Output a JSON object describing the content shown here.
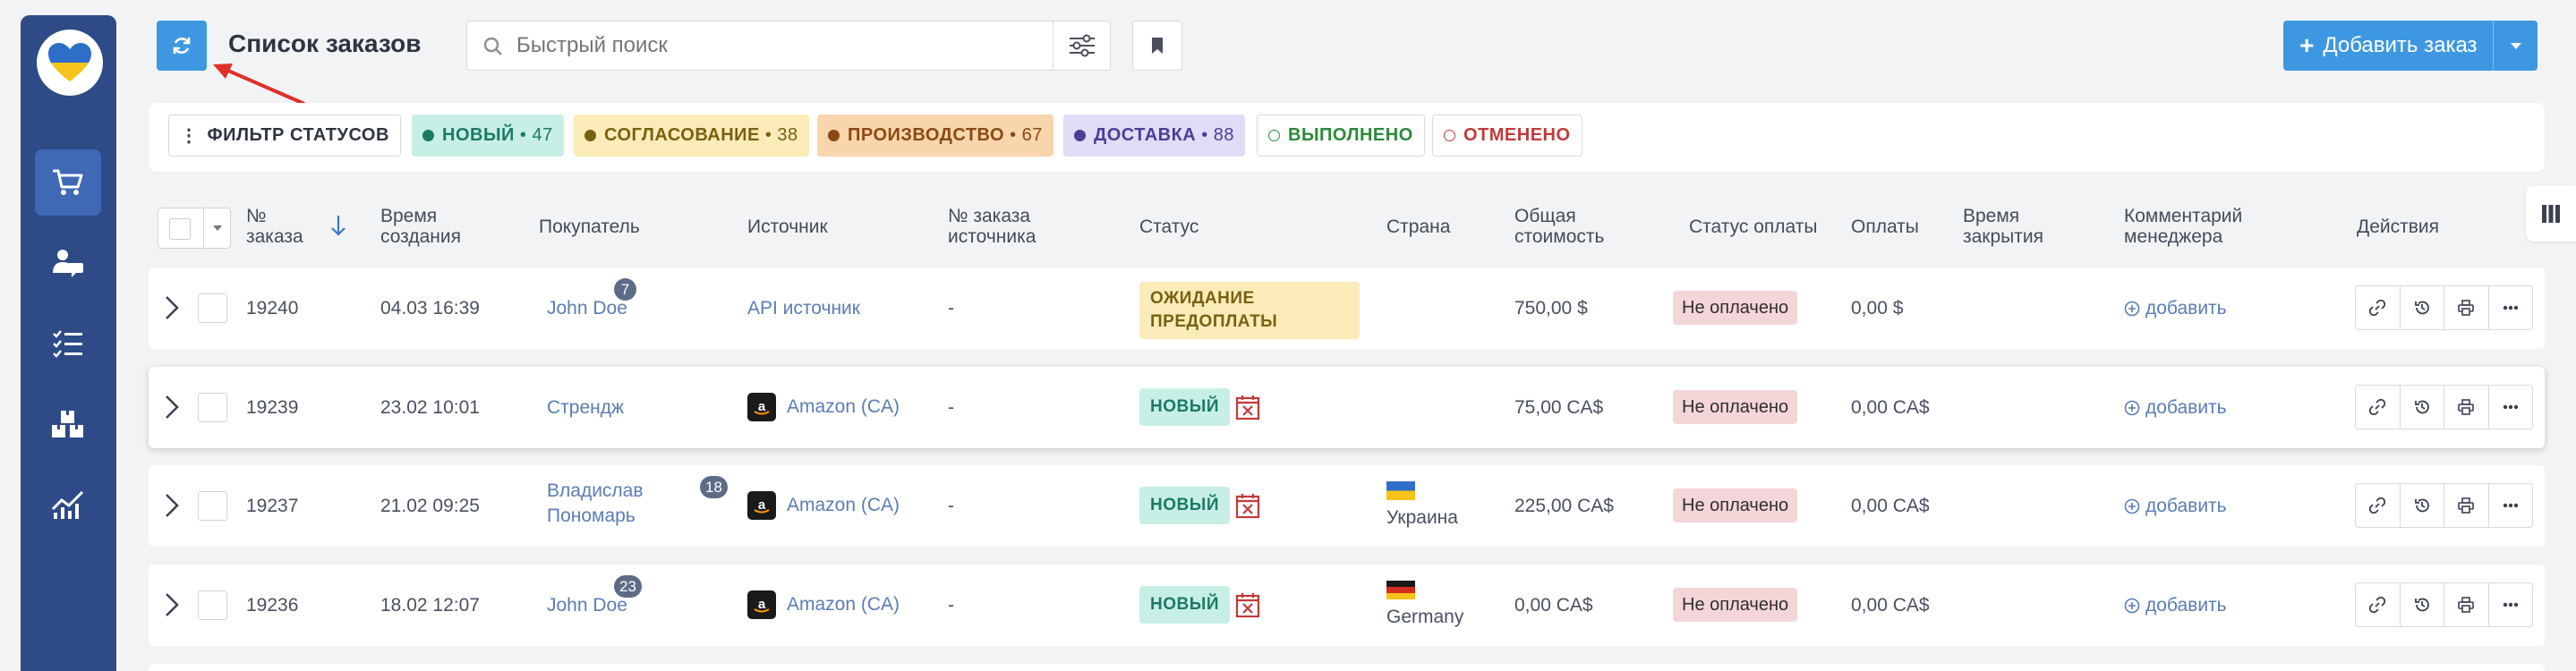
{
  "header": {
    "title": "Список заказов",
    "search_placeholder": "Быстрый поиск",
    "add_order_label": "Добавить заказ"
  },
  "colors": {
    "sidebar": "#2e4a87",
    "accent": "#3e98e1"
  },
  "sidebar": {
    "items": [
      {
        "icon": "cart-icon",
        "active": true
      },
      {
        "icon": "users-chat-icon",
        "active": false
      },
      {
        "icon": "checklist-icon",
        "active": false
      },
      {
        "icon": "boxes-icon",
        "active": false
      },
      {
        "icon": "analytics-icon",
        "active": false
      }
    ]
  },
  "status_filter": {
    "label": "ФИЛЬТР СТАТУСОВ",
    "chips": [
      {
        "label": "НОВЫЙ",
        "count": "• 47",
        "bg": "#c8efe6",
        "fg": "#1c7a63",
        "dot": "#1c7a63"
      },
      {
        "label": "СОГЛАСОВАНИЕ",
        "count": "• 38",
        "bg": "#faebb8",
        "fg": "#7a6012",
        "dot": "#7a6012"
      },
      {
        "label": "ПРОИЗВОДСТВО",
        "count": "• 67",
        "bg": "#f8d5ab",
        "fg": "#8a4a15",
        "dot": "#8a4a15"
      },
      {
        "label": "ДОСТАВКА",
        "count": "• 88",
        "bg": "#e1dcf6",
        "fg": "#4f3c95",
        "dot": "#4f3c95"
      },
      {
        "label": "ВЫПОЛНЕНО",
        "count": "",
        "bg": "#ffffff",
        "fg": "#2c8a3a",
        "dot": ""
      },
      {
        "label": "ОТМЕНЕНО",
        "count": "",
        "bg": "#ffffff",
        "fg": "#c23a3a",
        "dot": ""
      }
    ]
  },
  "table": {
    "columns": {
      "order_no": "№ заказа",
      "created": "Время создания",
      "buyer": "Покупатель",
      "source": "Источник",
      "source_order": "№ заказа источника",
      "status": "Статус",
      "country": "Страна",
      "total": "Общая стоимость",
      "pay_status": "Статус оплаты",
      "payments": "Оплаты",
      "closed": "Время закрытия",
      "comment": "Комментарий менеджера",
      "actions": "Действия"
    },
    "add_comment_label": "добавить",
    "rows": [
      {
        "id": "19240",
        "created": "04.03 16:39",
        "buyer": "John Doe",
        "buyer_badge": "7",
        "source": "API источник",
        "source_amazon": false,
        "source_order": "-",
        "status": "ОЖИДАНИЕ ПРЕДОПЛАТЫ",
        "status_type": "waiting",
        "country": "",
        "flag": "",
        "total": "750,00 $",
        "pay_status": "Не оплачено",
        "payments": "0,00 $"
      },
      {
        "id": "19239",
        "created": "23.02 10:01",
        "buyer": "Стрендж",
        "buyer_badge": "",
        "source": "Amazon (CA)",
        "source_amazon": true,
        "source_order": "-",
        "status": "НОВЫЙ",
        "status_type": "new",
        "country": "",
        "flag": "",
        "total": "75,00 CA$",
        "pay_status": "Не оплачено",
        "payments": "0,00 CA$"
      },
      {
        "id": "19237",
        "created": "21.02 09:25",
        "buyer": "Владислав Пономарь",
        "buyer_badge": "18",
        "source": "Amazon (CA)",
        "source_amazon": true,
        "source_order": "-",
        "status": "НОВЫЙ",
        "status_type": "new",
        "country": "Украина",
        "flag": "ua",
        "total": "225,00 CA$",
        "pay_status": "Не оплачено",
        "payments": "0,00 CA$"
      },
      {
        "id": "19236",
        "created": "18.02 12:07",
        "buyer": "John Doe",
        "buyer_badge": "23",
        "source": "Amazon (CA)",
        "source_amazon": true,
        "source_order": "-",
        "status": "НОВЫЙ",
        "status_type": "new",
        "country": "Germany",
        "flag": "de",
        "total": "0,00 CA$",
        "pay_status": "Не оплачено",
        "payments": "0,00 CA$"
      }
    ]
  }
}
